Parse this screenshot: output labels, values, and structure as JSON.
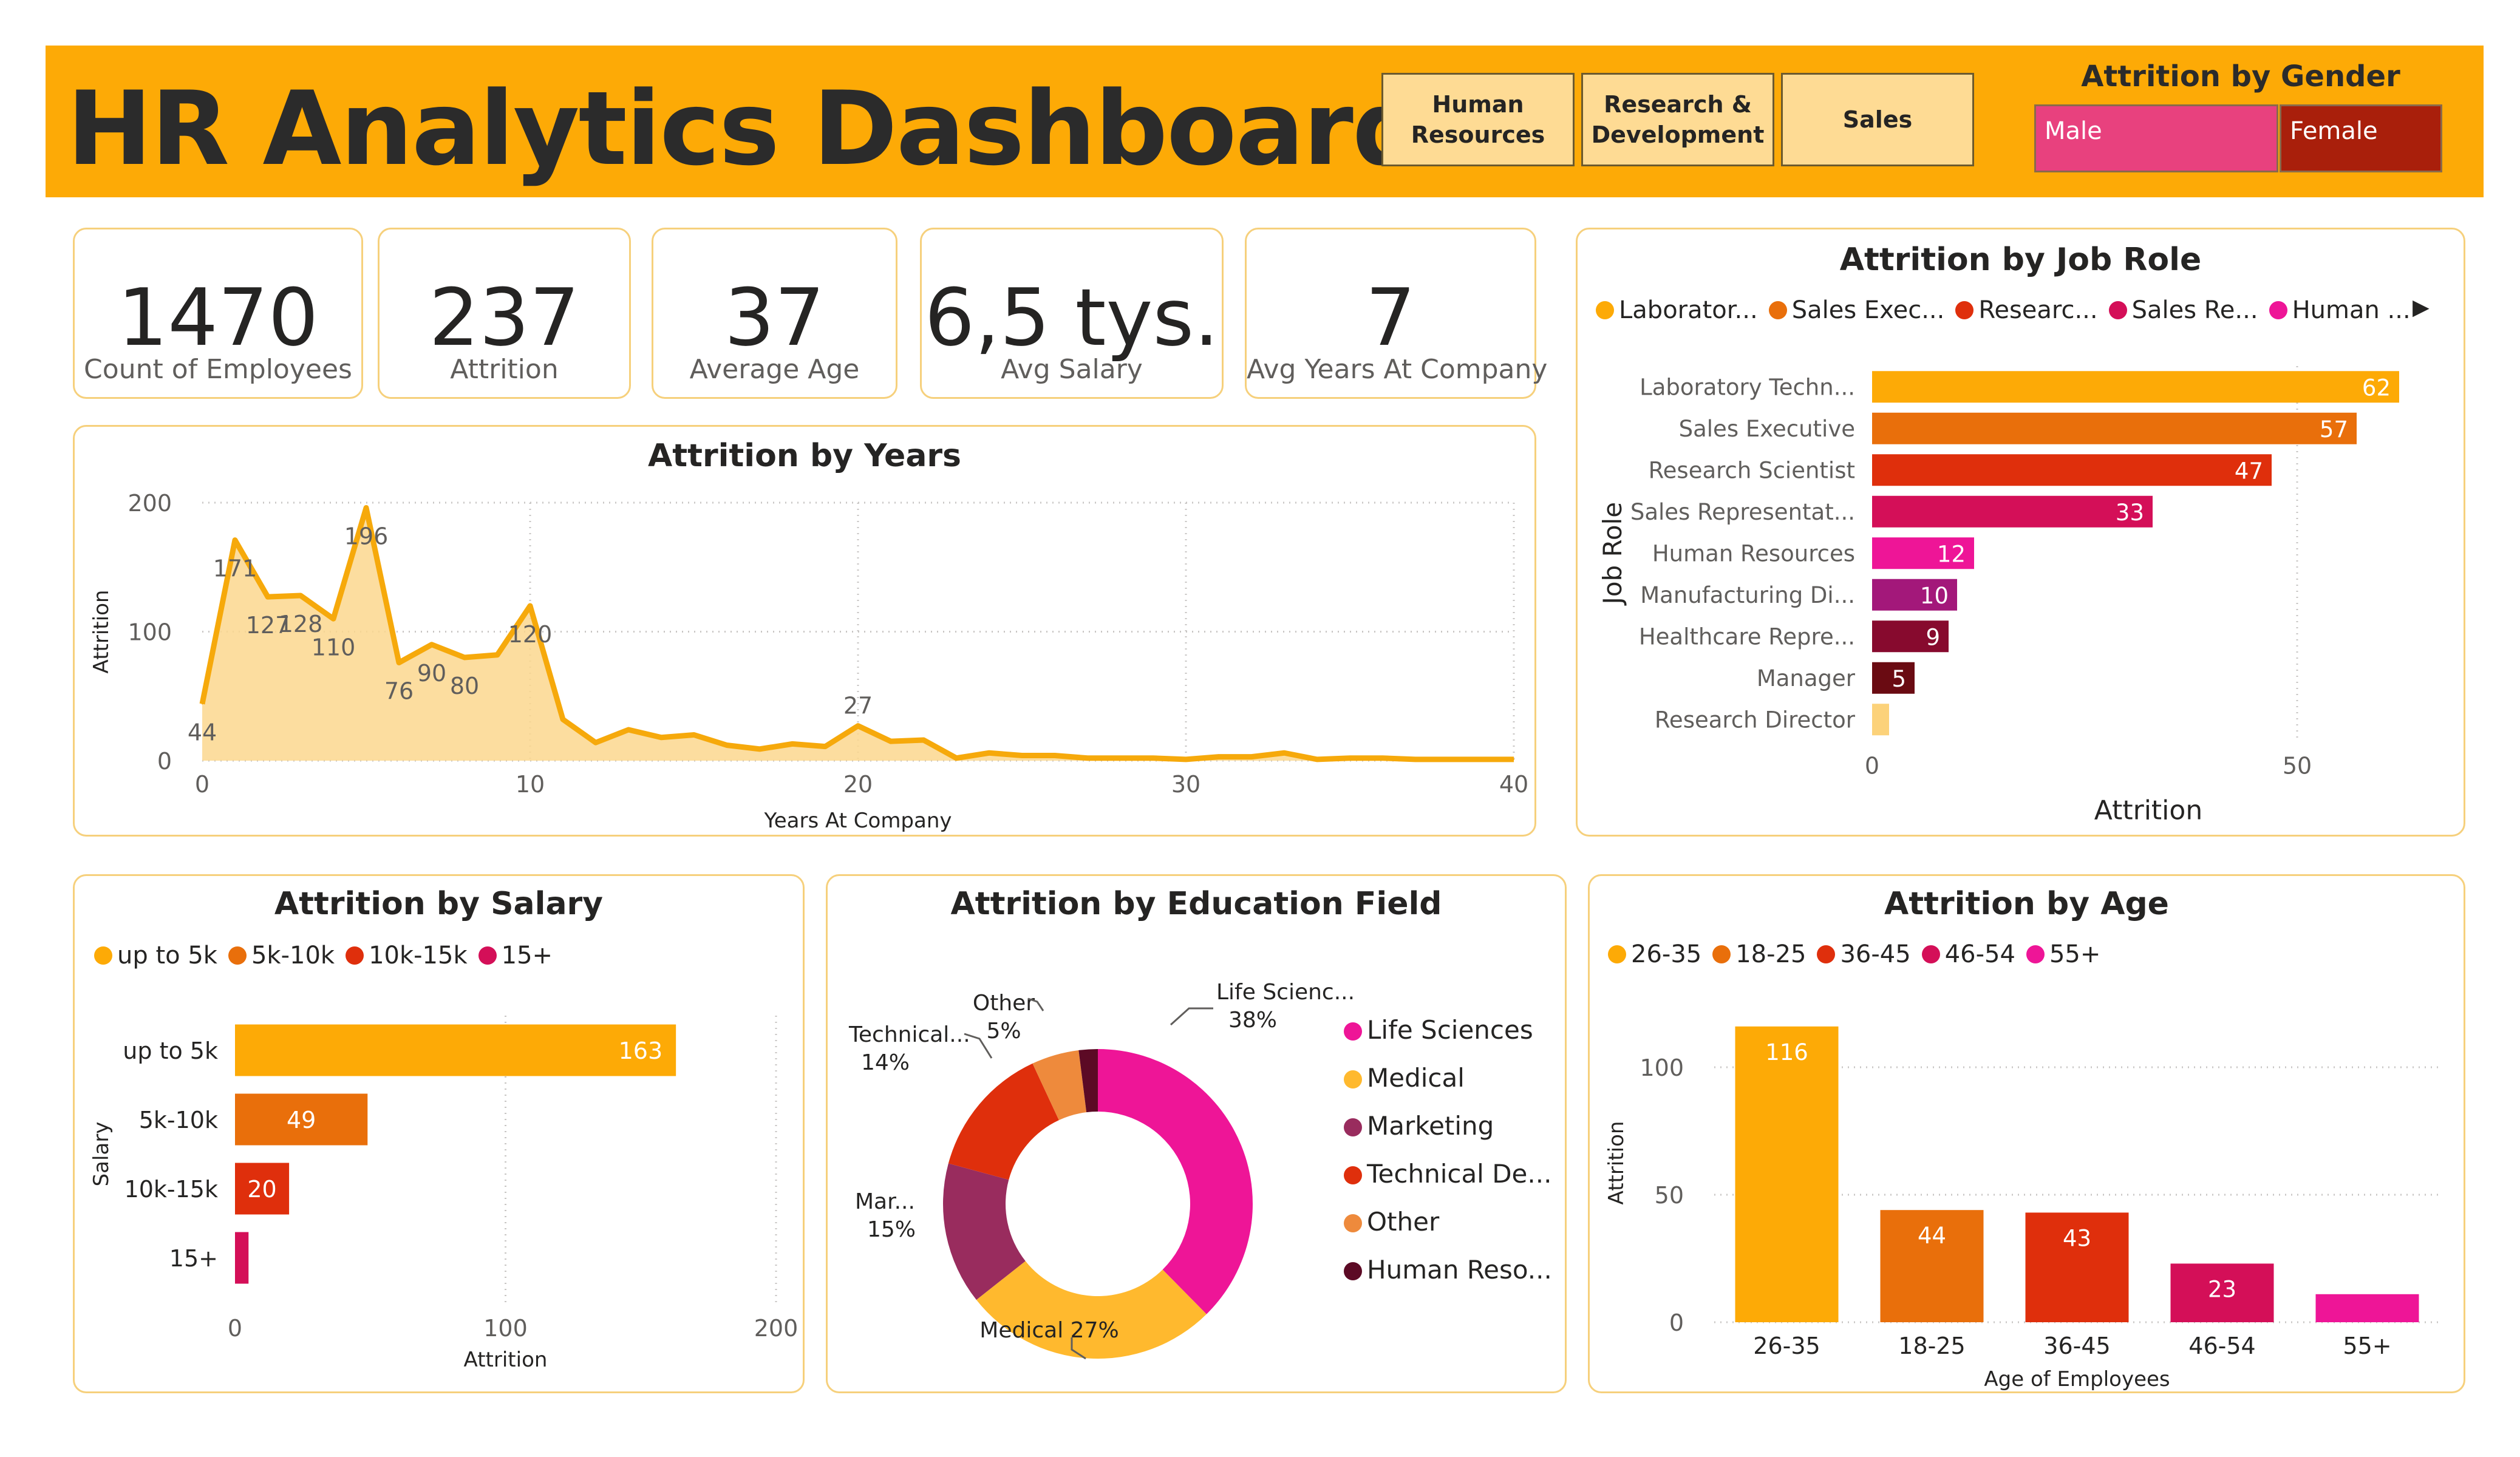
{
  "header": {
    "title": "HR Analytics Dashboard",
    "slicers": [
      "Human Resources",
      "Research & Development",
      "Sales"
    ],
    "gender": {
      "title": "Attrition by Gender",
      "male": "Male",
      "female": "Female",
      "male_color": "#E8417E",
      "female_color": "#A91F0B"
    }
  },
  "kpis": [
    {
      "value": "1470",
      "label": "Count of Employees"
    },
    {
      "value": "237",
      "label": "Attrition"
    },
    {
      "value": "37",
      "label": "Average Age"
    },
    {
      "value": "6,5 tys.",
      "label": "Avg Salary"
    },
    {
      "value": "7",
      "label": "Avg Years At Company"
    }
  ],
  "colors": {
    "accent": "#FDAA06",
    "card_border": "#F6D07C",
    "area_fill": "#FCD78E",
    "line": "#F6A90B"
  },
  "chart_data": [
    {
      "id": "years",
      "type": "area",
      "title": "Attrition by Years",
      "xlabel": "Years At Company",
      "ylabel": "Attrition",
      "xlim": [
        0,
        40
      ],
      "ylim": [
        0,
        200
      ],
      "xticks": [
        0,
        10,
        20,
        30,
        40
      ],
      "yticks": [
        0,
        100,
        200
      ],
      "x": [
        0,
        1,
        2,
        3,
        4,
        5,
        6,
        7,
        8,
        9,
        10,
        11,
        12,
        13,
        14,
        15,
        16,
        17,
        18,
        19,
        20,
        21,
        22,
        23,
        24,
        25,
        26,
        27,
        28,
        29,
        30,
        31,
        32,
        33,
        34,
        35,
        36,
        37,
        38,
        39,
        40
      ],
      "values": [
        44,
        171,
        127,
        128,
        110,
        196,
        76,
        90,
        80,
        82,
        120,
        32,
        14,
        24,
        18,
        20,
        12,
        9,
        13,
        11,
        27,
        15,
        16,
        2,
        6,
        4,
        4,
        2,
        2,
        2,
        1,
        3,
        3,
        6,
        1,
        2,
        2,
        1,
        1,
        1,
        1
      ],
      "labels": [
        [
          0,
          "44"
        ],
        [
          1,
          "171"
        ],
        [
          2,
          "127"
        ],
        [
          3,
          "128"
        ],
        [
          4,
          "110"
        ],
        [
          5,
          "196"
        ],
        [
          6,
          "76"
        ],
        [
          7,
          "90"
        ],
        [
          8,
          "80"
        ],
        [
          10,
          "120"
        ],
        [
          20,
          "27"
        ]
      ],
      "grid": true
    },
    {
      "id": "jobrole",
      "type": "bar",
      "orientation": "horizontal",
      "title": "Attrition by Job Role",
      "xlabel": "Attrition",
      "ylabel": "Job Role",
      "legend": [
        "Laborator...",
        "Sales Exec...",
        "Researc...",
        "Sales Re...",
        "Human ..."
      ],
      "legend_colors": [
        "#FDAA06",
        "#E96F0B",
        "#DF2F0C",
        "#D40F58",
        "#EE1597"
      ],
      "categories": [
        "Laboratory Techn...",
        "Sales Executive",
        "Research Scientist",
        "Sales Representat...",
        "Human Resources",
        "Manufacturing Di...",
        "Healthcare Repre...",
        "Manager",
        "Research Director"
      ],
      "values": [
        62,
        57,
        47,
        33,
        12,
        10,
        9,
        5,
        2
      ],
      "data_labels": [
        "62",
        "57",
        "47",
        "33",
        "12",
        "10",
        "9",
        "5",
        ""
      ],
      "colors": [
        "#FDAA06",
        "#E96F0B",
        "#DF2F0C",
        "#D40F58",
        "#EE1597",
        "#A3187A",
        "#870A2E",
        "#6A0B12",
        "#FCD27A"
      ],
      "xlim": [
        0,
        65
      ],
      "xticks": [
        0,
        50
      ],
      "grid": true
    },
    {
      "id": "salary",
      "type": "bar",
      "orientation": "horizontal",
      "title": "Attrition by Salary",
      "xlabel": "Attrition",
      "ylabel": "Salary",
      "legend": [
        "up to 5k",
        "5k-10k",
        "10k-15k",
        "15+"
      ],
      "legend_colors": [
        "#FDAA06",
        "#E96F0B",
        "#DF2F0C",
        "#D40F58"
      ],
      "categories": [
        "up to 5k",
        "5k-10k",
        "10k-15k",
        "15+"
      ],
      "values": [
        163,
        49,
        20,
        5
      ],
      "data_labels": [
        "163",
        "49",
        "20",
        ""
      ],
      "colors": [
        "#FDAA06",
        "#E96F0B",
        "#DF2F0C",
        "#D40F58"
      ],
      "xlim": [
        0,
        200
      ],
      "xticks": [
        0,
        100,
        200
      ],
      "grid": true
    },
    {
      "id": "education",
      "type": "pie",
      "donut": true,
      "title": "Attrition by Education Field",
      "slices": [
        {
          "name": "Life Sciences",
          "short": "Life Scienc...",
          "pct": 38,
          "color": "#EE1597"
        },
        {
          "name": "Medical",
          "short": "Medical",
          "pct": 27,
          "color": "#FFB92E"
        },
        {
          "name": "Marketing",
          "short": "Mar...",
          "pct": 15,
          "color": "#992C5E"
        },
        {
          "name": "Technical De...",
          "short": "Technical...",
          "pct": 14,
          "color": "#DF2F0C"
        },
        {
          "name": "Other",
          "short": "Other",
          "pct": 5,
          "color": "#EE8A3C"
        },
        {
          "name": "Human Reso...",
          "short": "",
          "pct": 2,
          "color": "#5C0A25"
        }
      ]
    },
    {
      "id": "age",
      "type": "bar",
      "orientation": "vertical",
      "title": "Attrition by Age",
      "xlabel": "Age of Employees",
      "ylabel": "Attrition",
      "legend": [
        "26-35",
        "18-25",
        "36-45",
        "46-54",
        "55+"
      ],
      "legend_colors": [
        "#FDAA06",
        "#E96F0B",
        "#DF2F0C",
        "#D40F58",
        "#EE1597"
      ],
      "categories": [
        "26-35",
        "18-25",
        "36-45",
        "46-54",
        "55+"
      ],
      "values": [
        116,
        44,
        43,
        23,
        11
      ],
      "data_labels": [
        "116",
        "44",
        "43",
        "23",
        ""
      ],
      "colors": [
        "#FDAA06",
        "#E96F0B",
        "#DF2F0C",
        "#D40F58",
        "#EE1597"
      ],
      "ylim": [
        0,
        125
      ],
      "yticks": [
        0,
        50,
        100
      ],
      "grid": true
    }
  ]
}
